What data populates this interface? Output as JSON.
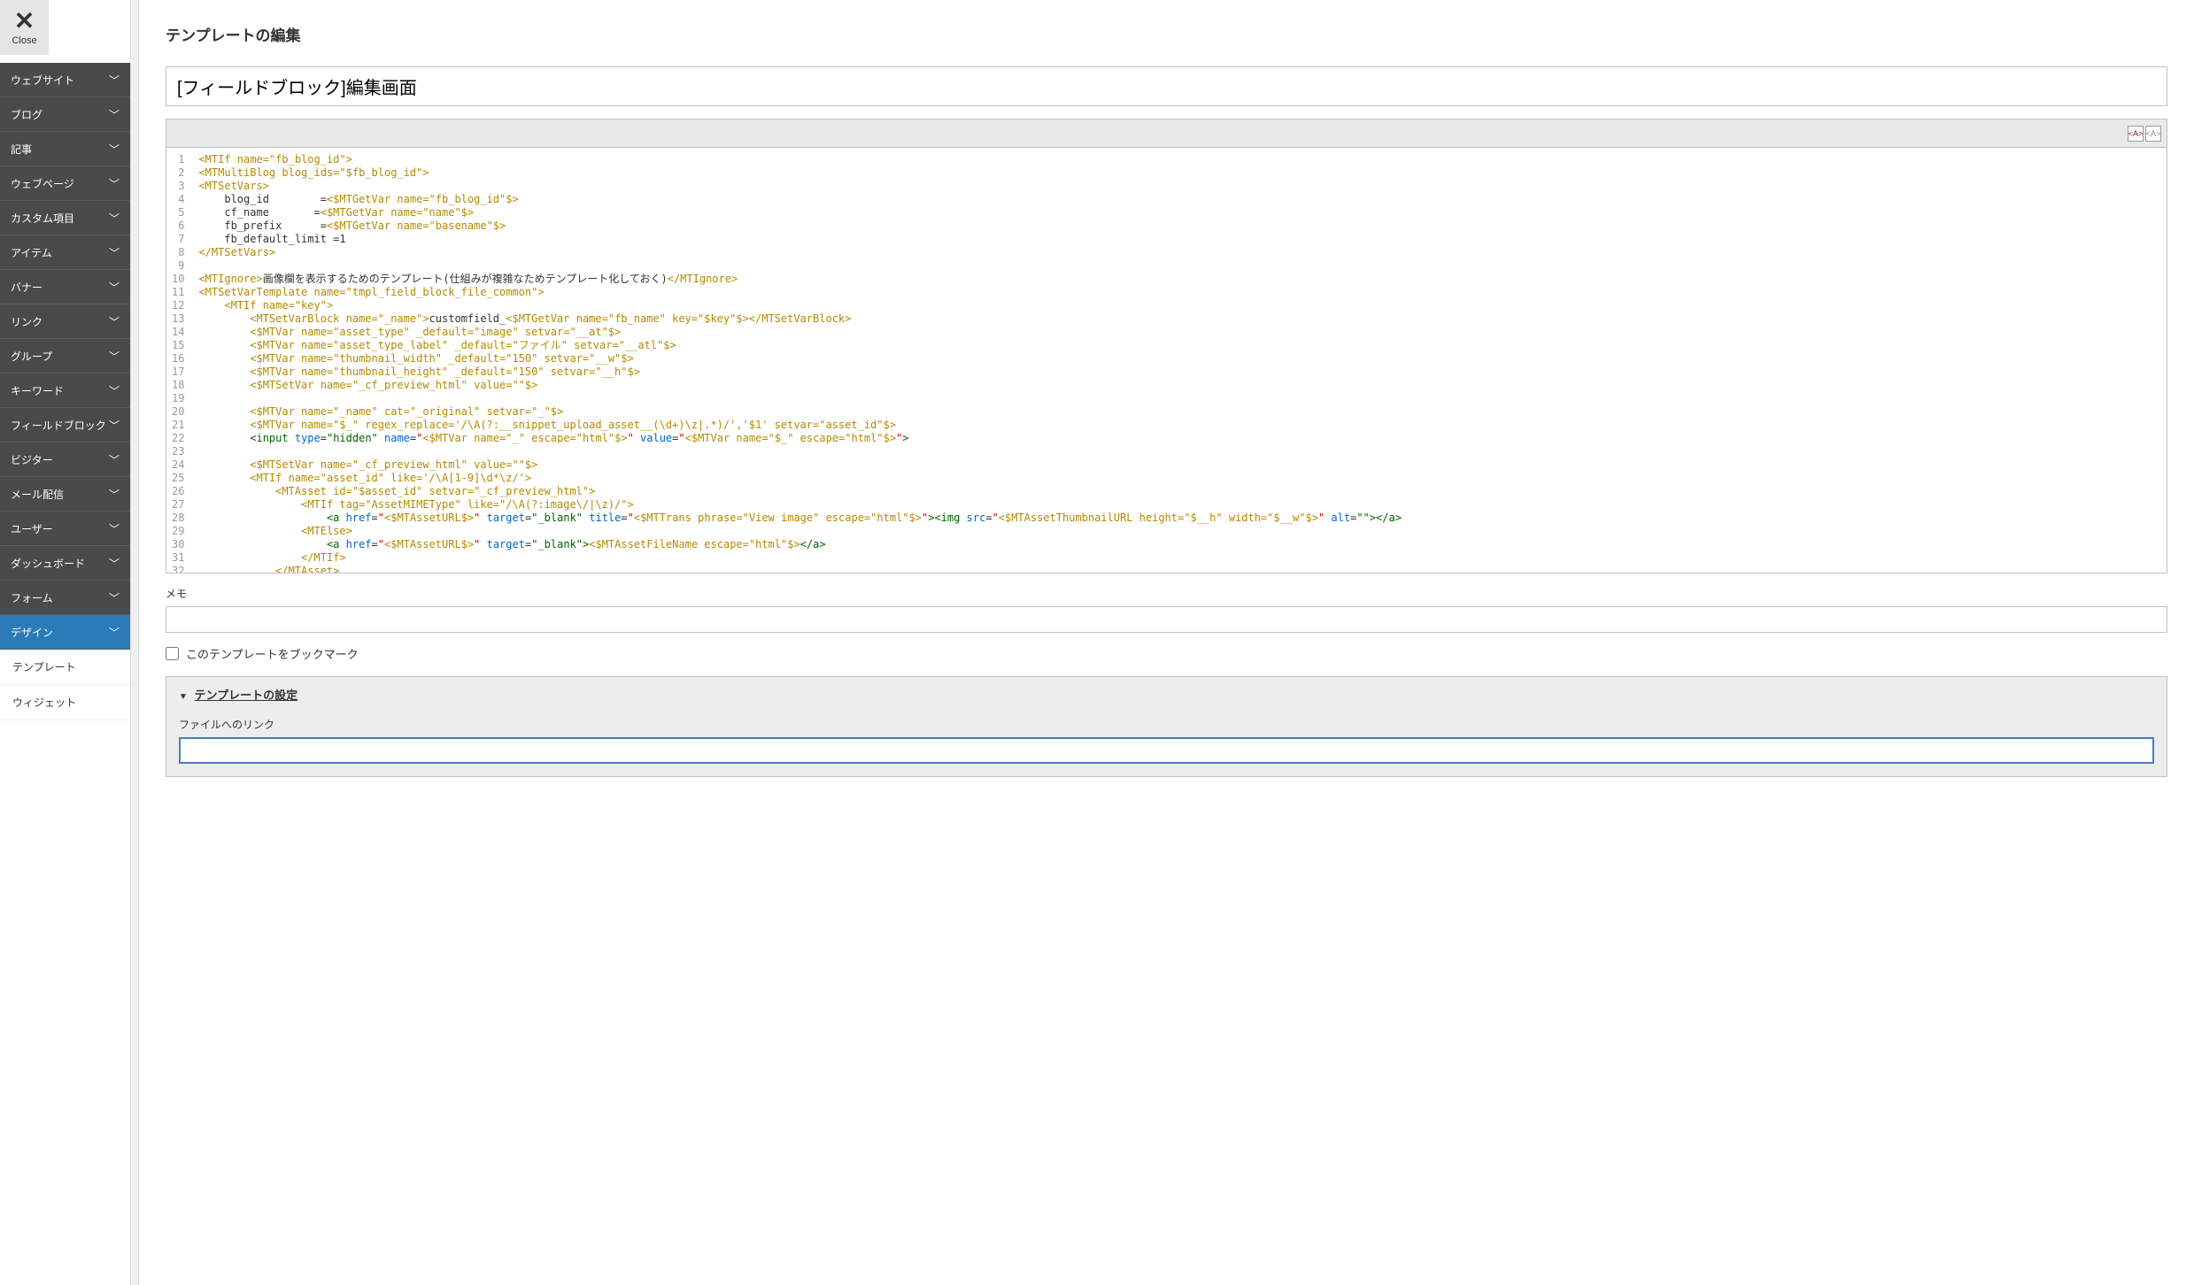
{
  "close": {
    "symbol": "✕",
    "label": "Close"
  },
  "sidebar": {
    "items": [
      {
        "label": "ウェブサイト",
        "active": false
      },
      {
        "label": "ブログ",
        "active": false
      },
      {
        "label": "記事",
        "active": false
      },
      {
        "label": "ウェブページ",
        "active": false
      },
      {
        "label": "カスタム項目",
        "active": false
      },
      {
        "label": "アイテム",
        "active": false
      },
      {
        "label": "バナー",
        "active": false
      },
      {
        "label": "リンク",
        "active": false
      },
      {
        "label": "グループ",
        "active": false
      },
      {
        "label": "キーワード",
        "active": false
      },
      {
        "label": "フィールドブロック",
        "active": false
      },
      {
        "label": "ビジター",
        "active": false
      },
      {
        "label": "メール配信",
        "active": false
      },
      {
        "label": "ユーザー",
        "active": false
      },
      {
        "label": "ダッシュボード",
        "active": false
      },
      {
        "label": "フォーム",
        "active": false
      },
      {
        "label": "デザイン",
        "active": true
      }
    ],
    "subitems": [
      {
        "label": "テンプレート"
      },
      {
        "label": "ウィジェット"
      }
    ]
  },
  "page": {
    "title": "テンプレートの編集",
    "template_name": "[フィールドブロック]編集画面",
    "memo_label": "メモ",
    "memo_value": "",
    "bookmark_label": "このテンプレートをブックマーク",
    "settings_title": "テンプレートの設定",
    "file_link_label": "ファイルへのリンク",
    "file_link_value": ""
  },
  "code": {
    "lines": [
      [
        {
          "t": "<MTIf name=\"fb_blog_id\">",
          "c": "c-tag"
        }
      ],
      [
        {
          "t": "<MTMultiBlog blog_ids=\"$fb_blog_id\">",
          "c": "c-tag"
        }
      ],
      [
        {
          "t": "<MTSetVars>",
          "c": "c-tag"
        }
      ],
      [
        {
          "t": "    blog_id        =",
          "c": "c-text"
        },
        {
          "t": "<$MTGetVar name=\"fb_blog_id\"$>",
          "c": "c-tag"
        }
      ],
      [
        {
          "t": "    cf_name       =",
          "c": "c-text"
        },
        {
          "t": "<$MTGetVar name=\"name\"$>",
          "c": "c-tag"
        }
      ],
      [
        {
          "t": "    fb_prefix      =",
          "c": "c-text"
        },
        {
          "t": "<$MTGetVar name=\"basename\"$>",
          "c": "c-tag"
        }
      ],
      [
        {
          "t": "    fb_default_limit =1",
          "c": "c-text"
        }
      ],
      [
        {
          "t": "</MTSetVars>",
          "c": "c-tag"
        }
      ],
      [
        {
          "t": "",
          "c": "c-text"
        }
      ],
      [
        {
          "t": "<MTIgnore>",
          "c": "c-tag"
        },
        {
          "t": "画像欄を表示するためのテンプレート(仕組みが複雑なためテンプレート化しておく)",
          "c": "c-text"
        },
        {
          "t": "</MTIgnore>",
          "c": "c-tag"
        }
      ],
      [
        {
          "t": "<MTSetVarTemplate name=\"tmpl_field_block_file_common\">",
          "c": "c-tag"
        }
      ],
      [
        {
          "t": "    <MTIf name=\"key\">",
          "c": "c-tag"
        }
      ],
      [
        {
          "t": "        <MTSetVarBlock name=\"_name\">",
          "c": "c-tag"
        },
        {
          "t": "customfield_",
          "c": "c-text"
        },
        {
          "t": "<$MTGetVar name=\"fb_name\" key=\"$key\"$></MTSetVarBlock>",
          "c": "c-tag"
        }
      ],
      [
        {
          "t": "        <$MTVar name=\"asset_type\" _default=\"image\" setvar=\"__at\"$>",
          "c": "c-tag"
        }
      ],
      [
        {
          "t": "        <$MTVar name=\"asset_type_label\" _default=\"ファイル\" setvar=\"__atl\"$>",
          "c": "c-tag"
        }
      ],
      [
        {
          "t": "        <$MTVar name=\"thumbnail_width\" _default=\"150\" setvar=\"__w\"$>",
          "c": "c-tag"
        }
      ],
      [
        {
          "t": "        <$MTVar name=\"thumbnail_height\" _default=\"150\" setvar=\"__h\"$>",
          "c": "c-tag"
        }
      ],
      [
        {
          "t": "        <$MTSetVar name=\"_cf_preview_html\" value=\"\"$>",
          "c": "c-tag"
        }
      ],
      [
        {
          "t": "",
          "c": "c-text"
        }
      ],
      [
        {
          "t": "        <$MTVar name=\"_name\" cat=\"_original\" setvar=\"_\"$>",
          "c": "c-tag"
        }
      ],
      [
        {
          "t": "        <$MTVar name=\"$_\" regex_replace='/\\A(?:__snippet_upload_asset__(\\d+)\\z|.*)/','$1' setvar=\"asset_id\"$>",
          "c": "c-tag"
        }
      ],
      [
        {
          "t": "        <input ",
          "c": "c-gt"
        },
        {
          "t": "type",
          "c": "c-kw"
        },
        {
          "t": "=",
          "c": "c-eq"
        },
        {
          "t": "\"hidden\"",
          "c": "c-strd"
        },
        {
          "t": " ",
          "c": "c-text"
        },
        {
          "t": "name",
          "c": "c-kw"
        },
        {
          "t": "=",
          "c": "c-eq"
        },
        {
          "t": "\"",
          "c": "c-str"
        },
        {
          "t": "<$MTVar name=\"_\" escape=\"html\"$>",
          "c": "c-tag"
        },
        {
          "t": "\"",
          "c": "c-str"
        },
        {
          "t": " ",
          "c": "c-text"
        },
        {
          "t": "value",
          "c": "c-kw"
        },
        {
          "t": "=",
          "c": "c-eq"
        },
        {
          "t": "\"",
          "c": "c-str"
        },
        {
          "t": "<$MTVar name=\"$_\" escape=\"html\"$>",
          "c": "c-tag"
        },
        {
          "t": "\"",
          "c": "c-str"
        },
        {
          "t": ">",
          "c": "c-gt"
        }
      ],
      [
        {
          "t": "",
          "c": "c-text"
        }
      ],
      [
        {
          "t": "        <$MTSetVar name=\"_cf_preview_html\" value=\"\"$>",
          "c": "c-tag"
        }
      ],
      [
        {
          "t": "        <MTIf name=\"asset_id\" like='/\\A[1-9]\\d*\\z/'>",
          "c": "c-tag"
        }
      ],
      [
        {
          "t": "            <MTAsset id=\"$asset_id\" setvar=\"_cf_preview_html\">",
          "c": "c-tag"
        }
      ],
      [
        {
          "t": "                <MTIf tag=\"AssetMIMEType\" like=\"/\\A(?:image\\/|\\z)/\">",
          "c": "c-tag"
        }
      ],
      [
        {
          "t": "                    <a ",
          "c": "c-gt"
        },
        {
          "t": "href",
          "c": "c-kw"
        },
        {
          "t": "=",
          "c": "c-eq"
        },
        {
          "t": "\"",
          "c": "c-str"
        },
        {
          "t": "<$MTAssetURL$>",
          "c": "c-tag"
        },
        {
          "t": "\"",
          "c": "c-str"
        },
        {
          "t": " ",
          "c": "c-text"
        },
        {
          "t": "target",
          "c": "c-kw"
        },
        {
          "t": "=",
          "c": "c-eq"
        },
        {
          "t": "\"_blank\"",
          "c": "c-strd"
        },
        {
          "t": " ",
          "c": "c-text"
        },
        {
          "t": "title",
          "c": "c-kw"
        },
        {
          "t": "=",
          "c": "c-eq"
        },
        {
          "t": "\"",
          "c": "c-str"
        },
        {
          "t": "<$MTTrans phrase=\"View image\" escape=\"html\"$>",
          "c": "c-tag"
        },
        {
          "t": "\"",
          "c": "c-str"
        },
        {
          "t": ">",
          "c": "c-gt"
        },
        {
          "t": "<img ",
          "c": "c-gt"
        },
        {
          "t": "src",
          "c": "c-kw"
        },
        {
          "t": "=",
          "c": "c-eq"
        },
        {
          "t": "\"",
          "c": "c-str"
        },
        {
          "t": "<$MTAssetThumbnailURL height=\"$__h\" width=\"$__w\"$>",
          "c": "c-tag"
        },
        {
          "t": "\"",
          "c": "c-str"
        },
        {
          "t": " ",
          "c": "c-text"
        },
        {
          "t": "alt",
          "c": "c-kw"
        },
        {
          "t": "=",
          "c": "c-eq"
        },
        {
          "t": "\"\"",
          "c": "c-strd"
        },
        {
          "t": ">",
          "c": "c-gt"
        },
        {
          "t": "</a>",
          "c": "c-gt"
        }
      ],
      [
        {
          "t": "                <MTElse>",
          "c": "c-tag"
        }
      ],
      [
        {
          "t": "                    <a ",
          "c": "c-gt"
        },
        {
          "t": "href",
          "c": "c-kw"
        },
        {
          "t": "=",
          "c": "c-eq"
        },
        {
          "t": "\"",
          "c": "c-str"
        },
        {
          "t": "<$MTAssetURL$>",
          "c": "c-tag"
        },
        {
          "t": "\"",
          "c": "c-str"
        },
        {
          "t": " ",
          "c": "c-text"
        },
        {
          "t": "target",
          "c": "c-kw"
        },
        {
          "t": "=",
          "c": "c-eq"
        },
        {
          "t": "\"_blank\"",
          "c": "c-strd"
        },
        {
          "t": ">",
          "c": "c-gt"
        },
        {
          "t": "<$MTAssetFileName escape=\"html\"$>",
          "c": "c-tag"
        },
        {
          "t": "</a>",
          "c": "c-gt"
        }
      ],
      [
        {
          "t": "                </MTIf>",
          "c": "c-tag"
        }
      ],
      [
        {
          "t": "            </MTAsset>",
          "c": "c-tag"
        }
      ]
    ]
  }
}
